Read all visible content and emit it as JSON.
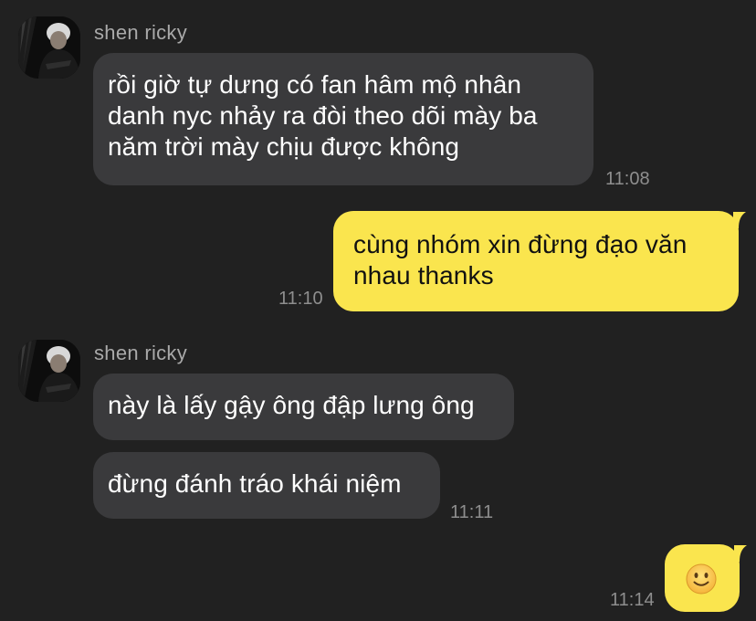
{
  "colors": {
    "background": "#212121",
    "incoming_bubble": "#3a3a3c",
    "outgoing_bubble": "#fae54e",
    "timestamp": "#8e8e8e",
    "sender_name": "#a9a9a9"
  },
  "messages": [
    {
      "sender": "shen ricky",
      "bubbles": [
        "rồi giờ tự dưng có fan hâm mộ nhân danh nyc nhảy ra đòi theo dõi mày ba năm trời mày chịu được không"
      ],
      "time": "11:08"
    },
    {
      "outgoing": true,
      "text": "cùng nhóm xin đừng đạo văn nhau thanks",
      "time": "11:10"
    },
    {
      "sender": "shen ricky",
      "bubbles": [
        "này là lấy gậy ông đập lưng ông",
        "đừng đánh tráo khái niệm"
      ],
      "time": "11:11"
    },
    {
      "outgoing": true,
      "text": "🙂",
      "icon": "slightly-smiling-face-emoji",
      "time": "11:14"
    }
  ]
}
